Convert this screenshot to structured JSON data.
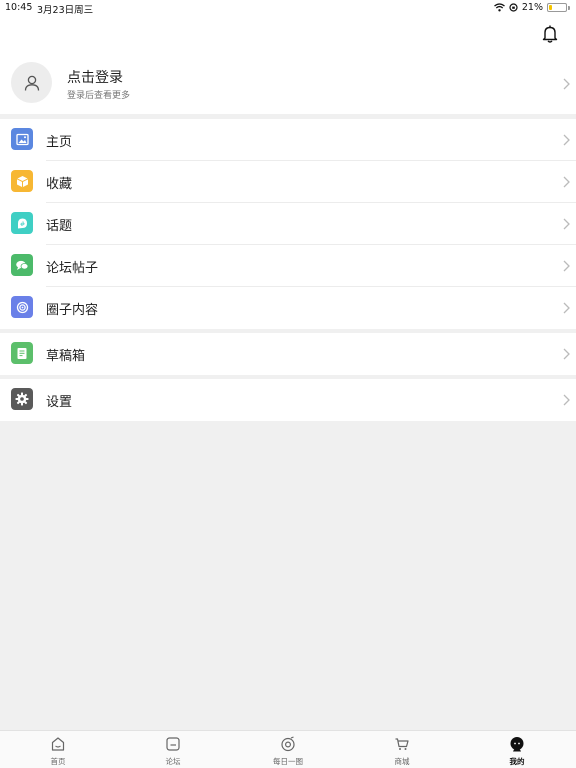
{
  "status_bar": {
    "time": "10:45",
    "date": "3月23日周三",
    "battery_percent": "21%",
    "battery_level": 0.21
  },
  "header": {
    "bell_icon": "bell-icon"
  },
  "login": {
    "title": "点击登录",
    "subtitle": "登录后查看更多",
    "avatar_icon": "person-icon"
  },
  "menu_group_1": [
    {
      "label": "主页",
      "icon": "image-icon",
      "color": "#5b87e0"
    },
    {
      "label": "收藏",
      "icon": "box-icon",
      "color": "#f7b733"
    },
    {
      "label": "话题",
      "icon": "topic-icon",
      "color": "#3fcfc4"
    },
    {
      "label": "论坛帖子",
      "icon": "chat-icon",
      "color": "#4cba6a"
    },
    {
      "label": "圈子内容",
      "icon": "circle-icon",
      "color": "#6a80e8"
    }
  ],
  "menu_group_2": [
    {
      "label": "草稿箱",
      "icon": "draft-icon",
      "color": "#5cbf6b"
    }
  ],
  "menu_group_3": [
    {
      "label": "设置",
      "icon": "gear-icon",
      "color": "#5a5a5a"
    }
  ],
  "tabbar": [
    {
      "label": "首页",
      "icon": "home-icon",
      "active": false
    },
    {
      "label": "论坛",
      "icon": "forum-icon",
      "active": false
    },
    {
      "label": "每日一图",
      "icon": "daily-image-icon",
      "active": false
    },
    {
      "label": "商城",
      "icon": "cart-icon",
      "active": false
    },
    {
      "label": "我的",
      "icon": "profile-icon",
      "active": true
    }
  ]
}
